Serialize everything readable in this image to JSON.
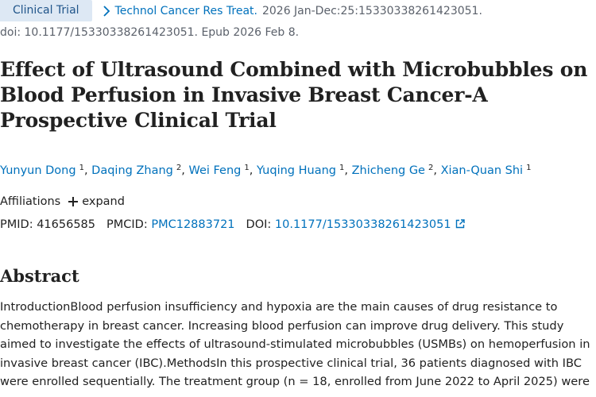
{
  "citation": {
    "publication_type": "Clinical Trial",
    "journal": "Technol Cancer Res Treat.",
    "citation_details": "2026 Jan-Dec:25:15330338261423051.",
    "doi_line": "doi: 10.1177/15330338261423051. Epub 2026 Feb 8."
  },
  "article": {
    "title": "Effect of Ultrasound Combined with Microbubbles on Blood Perfusion in Invasive Breast Cancer-A Prospective Clinical Trial"
  },
  "authors": [
    {
      "name": "Yunyun Dong",
      "affiliation": "1"
    },
    {
      "name": "Daqing Zhang",
      "affiliation": "2"
    },
    {
      "name": "Wei Feng",
      "affiliation": "1"
    },
    {
      "name": "Yuqing Huang",
      "affiliation": "1"
    },
    {
      "name": "Zhicheng Ge",
      "affiliation": "2"
    },
    {
      "name": "Xian-Quan Shi",
      "affiliation": "1"
    }
  ],
  "affiliations": {
    "label": "Affiliations",
    "expand_label": "expand"
  },
  "identifiers": {
    "pmid_label": "PMID:",
    "pmid": "41656585",
    "pmcid_label": "PMCID:",
    "pmcid": "PMC12883721",
    "doi_label": "DOI:",
    "doi": "10.1177/15330338261423051"
  },
  "abstract": {
    "heading": "Abstract",
    "text": "IntroductionBlood perfusion insufficiency and hypoxia are the main causes of drug resistance to chemotherapy in breast cancer. Increasing blood perfusion can improve drug delivery. This study aimed to investigate the effects of ultrasound-stimulated microbubbles (USMBs) on hemoperfusion in invasive breast cancer (IBC).MethodsIn this prospective clinical trial, 36 patients diagnosed with IBC were enrolled sequentially. The treatment group (n = 18, enrolled from June 2022 to April 2025) were"
  },
  "colors": {
    "link": "#0071bc",
    "badge_background": "#dde8f4",
    "badge_text": "#20558a",
    "muted_text": "#5b616b",
    "body_text": "#212121"
  }
}
